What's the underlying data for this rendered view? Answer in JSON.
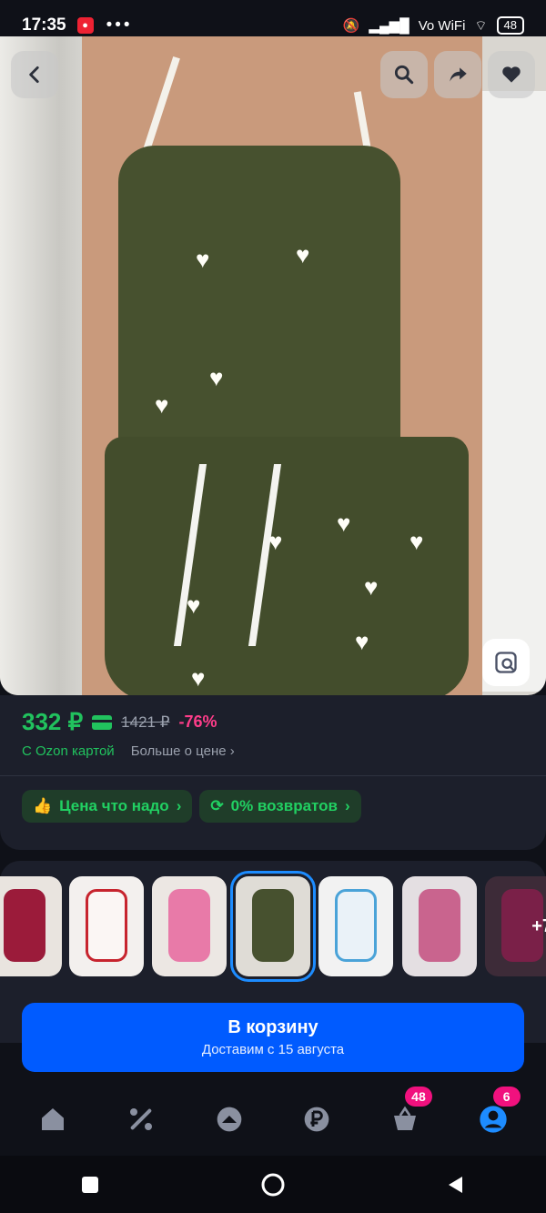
{
  "status_bar": {
    "time": "17:35",
    "network": "Vo WiFi",
    "battery": "48"
  },
  "hero": {
    "overlay_buttons": [
      "back-icon",
      "search-icon",
      "share-icon",
      "heart-icon"
    ],
    "visual_search_icon": "image-search-icon"
  },
  "price": {
    "current": "332 ₽",
    "old": "1421 ₽",
    "discount": "-76%",
    "ozon_card_label": "С Ozon картой",
    "more_label": "Больше о цене",
    "chips": [
      "Цена что надо",
      "0% возвратов"
    ]
  },
  "variants": {
    "more_count": "+7",
    "selected_index": 3
  },
  "cart": {
    "title": "В корзину",
    "subtitle": "Доставим с 15 августа"
  },
  "nav": {
    "items": [
      "home-icon",
      "discount-icon",
      "catalog-icon",
      "finance-icon",
      "cart-icon",
      "profile-icon"
    ],
    "cart_badge": "48",
    "profile_badge": "6"
  },
  "colors": {
    "accent": "#005bff",
    "green": "#21c25e",
    "pink": "#f1117e",
    "card": "#1c1f2b",
    "bg": "#0f1118"
  }
}
